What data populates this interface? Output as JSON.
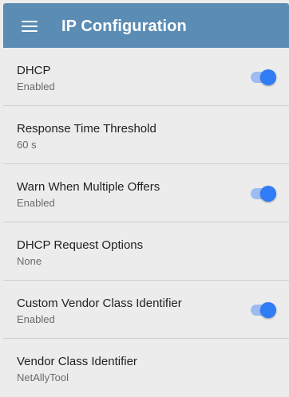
{
  "header": {
    "title": "IP Configuration",
    "menu_icon": "hamburger-menu-icon"
  },
  "settings": [
    {
      "label": "DHCP",
      "value": "Enabled",
      "toggle": true,
      "toggle_on": true
    },
    {
      "label": "Response Time Threshold",
      "value": "60 s",
      "toggle": false
    },
    {
      "label": "Warn When Multiple Offers",
      "value": "Enabled",
      "toggle": true,
      "toggle_on": true
    },
    {
      "label": "DHCP Request Options",
      "value": "None",
      "toggle": false
    },
    {
      "label": "Custom Vendor Class Identifier",
      "value": "Enabled",
      "toggle": true,
      "toggle_on": true
    },
    {
      "label": "Vendor Class Identifier",
      "value": "NetAllyTool",
      "toggle": false
    }
  ],
  "colors": {
    "appbar": "#5b8cb4",
    "toggle_thumb": "#2f7cf6",
    "toggle_track": "#9dbdf2",
    "background": "#ececec"
  }
}
